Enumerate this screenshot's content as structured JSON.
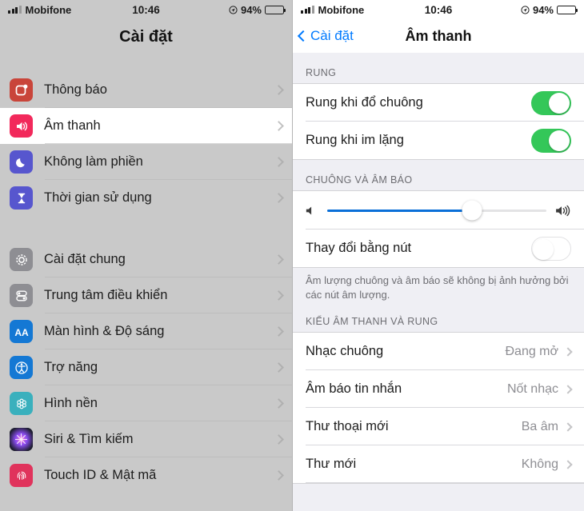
{
  "status_bar": {
    "carrier": "Mobifone",
    "time": "10:46",
    "battery_percent": "94%",
    "signal_icon": "signal-bars-icon",
    "location_icon": "location-services-icon",
    "battery_icon": "battery-icon"
  },
  "left_pane": {
    "title": "Cài đặt",
    "groups": [
      {
        "items": [
          {
            "label": "Thông báo",
            "icon": "notifications-icon",
            "icon_bg": "#c9453a",
            "selected": false
          },
          {
            "label": "Âm thanh",
            "icon": "sounds-speaker-icon",
            "icon_bg": "#f2295b",
            "selected": true
          },
          {
            "label": "Không làm phiền",
            "icon": "do-not-disturb-moon-icon",
            "icon_bg": "#5756ce",
            "selected": false
          },
          {
            "label": "Thời gian sử dụng",
            "icon": "screen-time-hourglass-icon",
            "icon_bg": "#5756ce",
            "selected": false
          }
        ]
      },
      {
        "items": [
          {
            "label": "Cài đặt chung",
            "icon": "general-gear-icon",
            "icon_bg": "#8e8e93",
            "selected": false
          },
          {
            "label": "Trung tâm điều khiển",
            "icon": "control-center-toggles-icon",
            "icon_bg": "#8e8e93",
            "selected": false
          },
          {
            "label": "Màn hình & Độ sáng",
            "icon": "display-brightness-aa-icon",
            "icon_bg": "#1478d4",
            "selected": false
          },
          {
            "label": "Trợ năng",
            "icon": "accessibility-icon",
            "icon_bg": "#1478d4",
            "selected": false
          },
          {
            "label": "Hình nền",
            "icon": "wallpaper-flower-icon",
            "icon_bg": "#3ab0bd",
            "selected": false
          },
          {
            "label": "Siri & Tìm kiếm",
            "icon": "siri-icon",
            "icon_bg": "#2b2b3d",
            "selected": false
          },
          {
            "label": "Touch ID & Mật mã",
            "icon": "touch-id-fingerprint-icon",
            "icon_bg": "#e0335c",
            "selected": false
          }
        ]
      }
    ]
  },
  "right_pane": {
    "back_label": "Cài đặt",
    "title": "Âm thanh",
    "section_vibrate": {
      "header": "RUNG",
      "rows": [
        {
          "label": "Rung khi đổ chuông",
          "state": "on"
        },
        {
          "label": "Rung khi im lặng",
          "state": "on"
        }
      ]
    },
    "section_ringer": {
      "header": "CHUÔNG VÀ ÂM BÁO",
      "slider": {
        "value_percent": 66,
        "min_icon": "speaker-low-icon",
        "max_icon": "speaker-high-icon",
        "fill_color": "#0a6fd8"
      },
      "change_with_buttons": {
        "label": "Thay đổi bằng nút",
        "state": "off"
      },
      "footnote": "Âm lượng chuông và âm báo sẽ không bị ảnh hưởng bởi các nút âm lượng."
    },
    "section_sounds": {
      "header": "KIỂU ÂM THANH VÀ RUNG",
      "rows": [
        {
          "label": "Nhạc chuông",
          "value": "Đang mở"
        },
        {
          "label": "Âm báo tin nhắn",
          "value": "Nốt nhạc"
        },
        {
          "label": "Thư thoại mới",
          "value": "Ba âm"
        },
        {
          "label": "Thư mới",
          "value": "Không"
        }
      ]
    }
  },
  "colors": {
    "toggle_on": "#34c759",
    "accent_blue": "#007aff",
    "slider_blue": "#0a6fd8"
  }
}
